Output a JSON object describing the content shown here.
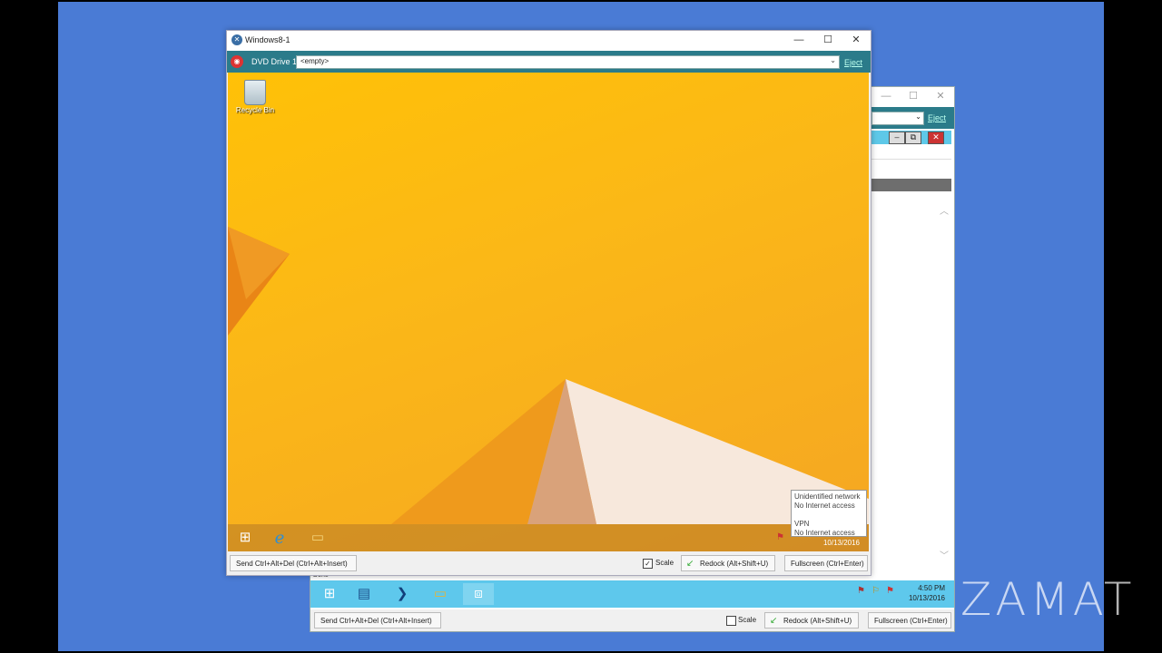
{
  "watermark": "ZAMAT",
  "back_window": {
    "eject_label": "Eject",
    "status_text": "Done",
    "tray_time": "4:50 PM",
    "tray_date": "10/13/2016",
    "send_cad_label": "Send Ctrl+Alt+Del (Ctrl+Alt+Insert)",
    "scale_label": "Scale",
    "redock_label": "Redock (Alt+Shift+U)",
    "fullscreen_label": "Fullscreen (Ctrl+Enter)"
  },
  "front_window": {
    "title": "Windows8-1",
    "dvd_label": "DVD Drive 1:",
    "dvd_value": "<empty>",
    "eject_label": "Eject",
    "desktop_icon_label": "Recycle Bin",
    "vm_tray_date": "10/13/2016",
    "network_popup": {
      "line1": "Unidentified network",
      "line2": "No Internet access",
      "line3": "VPN",
      "line4": "No Internet access"
    },
    "send_cad_label": "Send Ctrl+Alt+Del (Ctrl+Alt+Insert)",
    "scale_label": "Scale",
    "scale_checked": true,
    "redock_label": "Redock (Alt+Shift+U)",
    "fullscreen_label": "Fullscreen (Ctrl+Enter)"
  }
}
